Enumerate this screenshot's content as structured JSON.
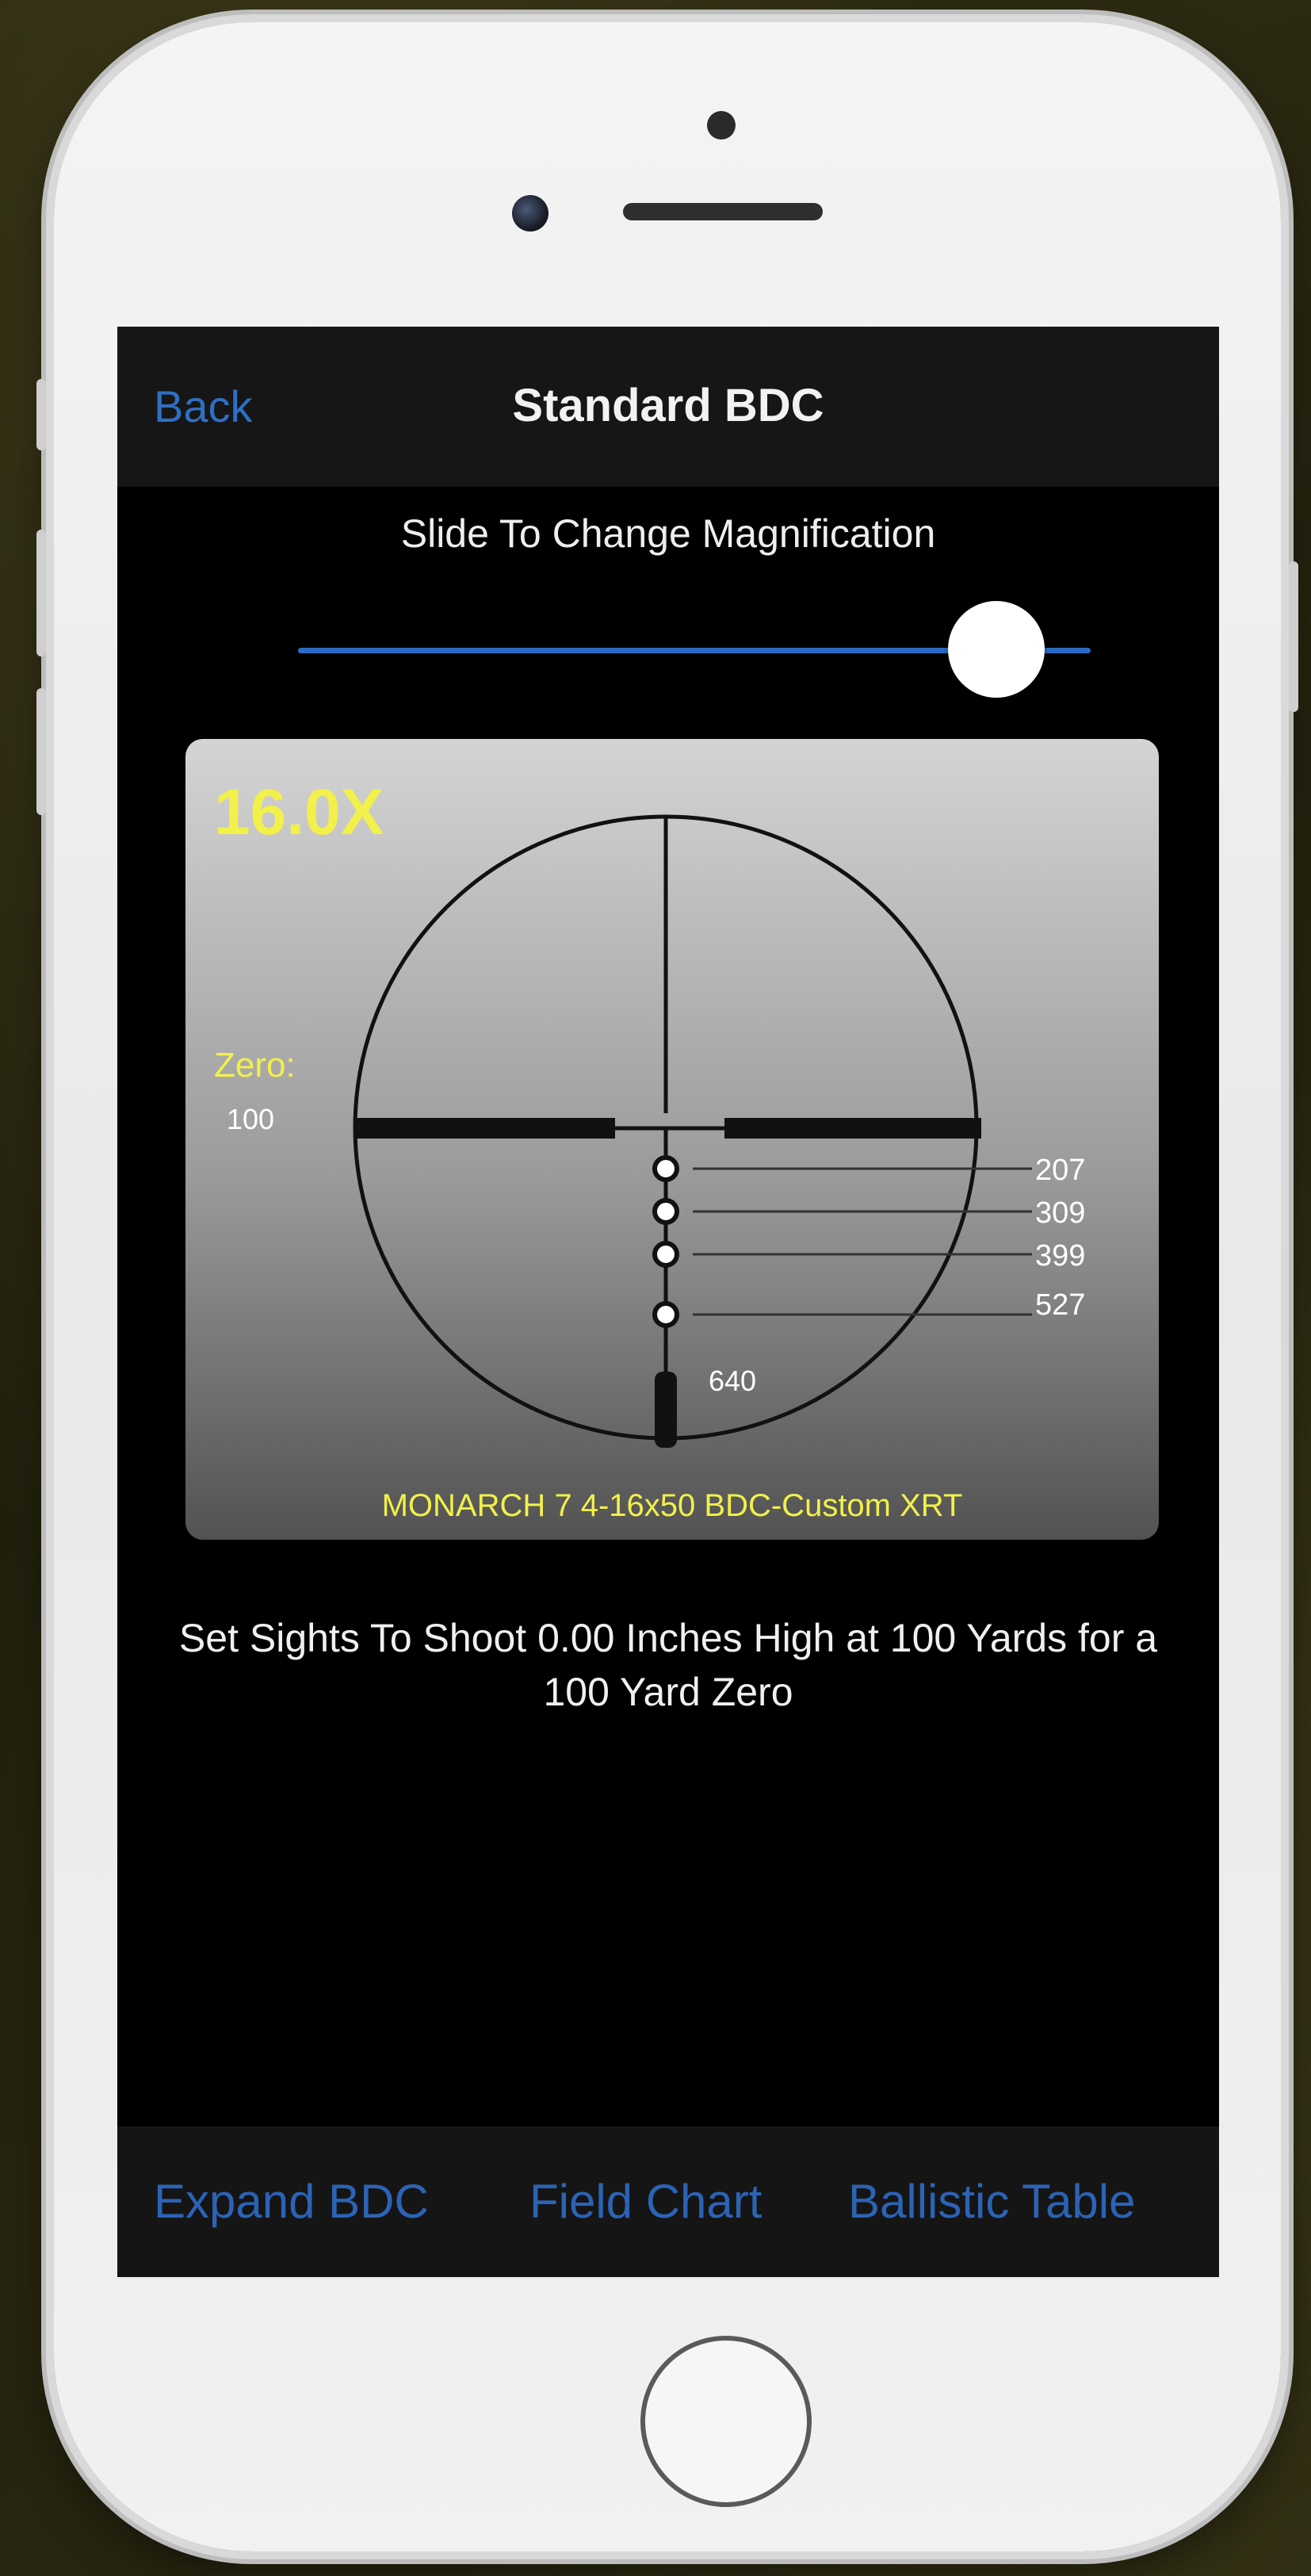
{
  "nav": {
    "back_label": "Back",
    "title": "Standard BDC"
  },
  "magnification": {
    "caption": "Slide To Change Magnification",
    "value_label": "16.0X",
    "slider_value": 1.0
  },
  "reticle": {
    "zero_label": "Zero:",
    "zero_value": "100",
    "marks": [
      "207",
      "309",
      "399",
      "527"
    ],
    "bottom_mark": "640",
    "scope_name": "MONARCH 7 4-16x50 BDC-Custom XRT"
  },
  "instruction": "Set Sights To Shoot 0.00 Inches High at 100 Yards for a 100 Yard Zero",
  "tabs": [
    {
      "label": "Expand BDC"
    },
    {
      "label": "Field Chart"
    },
    {
      "label": "Ballistic Table"
    }
  ],
  "colors": {
    "accent_blue": "#2f6fc4",
    "label_yellow": "#f2f04a"
  }
}
